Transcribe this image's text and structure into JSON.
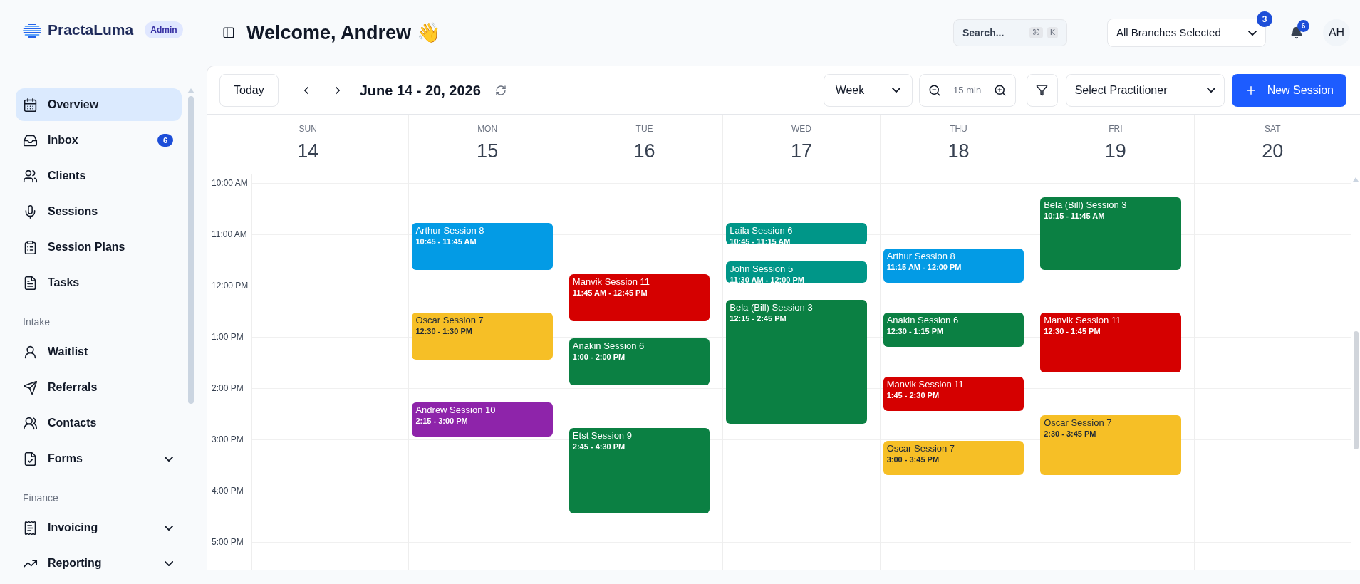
{
  "brand": {
    "name": "PractaLuma",
    "role": "Admin"
  },
  "sidebar": {
    "sections": [
      {
        "items": [
          {
            "label": "Overview",
            "selected": true,
            "collapsible": false
          },
          {
            "label": "Inbox",
            "selected": false,
            "badge": "6",
            "collapsible": false
          },
          {
            "label": "Clients",
            "selected": false,
            "collapsible": false
          },
          {
            "label": "Sessions",
            "selected": false,
            "collapsible": false
          },
          {
            "label": "Session Plans",
            "selected": false,
            "collapsible": false
          },
          {
            "label": "Tasks",
            "selected": false,
            "collapsible": false
          }
        ]
      },
      {
        "label": "Intake",
        "items": [
          {
            "label": "Waitlist",
            "selected": false,
            "collapsible": false
          },
          {
            "label": "Referrals",
            "selected": false,
            "collapsible": false
          },
          {
            "label": "Contacts",
            "selected": false,
            "collapsible": false
          },
          {
            "label": "Forms",
            "selected": false,
            "collapsible": true
          }
        ]
      },
      {
        "label": "Finance",
        "items": [
          {
            "label": "Invoicing",
            "selected": false,
            "collapsible": true
          },
          {
            "label": "Reporting",
            "selected": false,
            "collapsible": true
          }
        ]
      }
    ]
  },
  "header": {
    "title": "Welcome, Andrew 👋",
    "search": {
      "placeholder": "Search...",
      "keys": [
        "⌘",
        "K"
      ]
    },
    "branches": {
      "value": "All Branches Selected",
      "count": "3"
    },
    "notifications": "6",
    "avatar": "AH"
  },
  "toolbar": {
    "today": "Today",
    "range": "June 14 - 20, 2026",
    "view": "Week",
    "interval": "15 min",
    "practitioner": "Select Practitioner",
    "new_session": "New Session"
  },
  "times": [
    "10:00 AM",
    "11:00 AM",
    "12:00 PM",
    "1:00 PM",
    "2:00 PM",
    "3:00 PM",
    "4:00 PM",
    "5:00 PM"
  ],
  "days": [
    {
      "weekday": "SUN",
      "date": "14"
    },
    {
      "weekday": "MON",
      "date": "15",
      "events": [
        {
          "title": "Arthur Session 8",
          "time": "10:45 - 11:45 AM",
          "color": "#039be5"
        },
        {
          "title": "Oscar Session 7",
          "time": "12:30 - 1:30 PM",
          "color": "#f6bf26"
        },
        {
          "title": "Andrew Session 10",
          "time": "2:15 - 3:00 PM",
          "color": "#8e24aa"
        }
      ]
    },
    {
      "weekday": "TUE",
      "date": "16",
      "events": [
        {
          "title": "Manvik Session 11",
          "time": "11:45 AM - 12:45 PM",
          "color": "#d50000"
        },
        {
          "title": "Anakin Session 6",
          "time": "1:00 - 2:00 PM",
          "color": "#0b8043"
        },
        {
          "title": "Etst Session 9",
          "time": "2:45 - 4:30 PM",
          "color": "#0b8043"
        }
      ]
    },
    {
      "weekday": "WED",
      "date": "17",
      "events": [
        {
          "title": "Laila Session 6",
          "time": "10:45 - 11:15 AM",
          "color": "#009688"
        },
        {
          "title": "John Session 5",
          "time": "11:30 AM - 12:00 PM",
          "color": "#009688"
        },
        {
          "title": "Bela (Bill) Session 3",
          "time": "12:15 - 2:45 PM",
          "color": "#0b8043"
        }
      ]
    },
    {
      "weekday": "THU",
      "date": "18",
      "events": [
        {
          "title": "Arthur Session 8",
          "time": "11:15 AM - 12:00 PM",
          "color": "#039be5"
        },
        {
          "title": "Anakin Session 6",
          "time": "12:30 - 1:15 PM",
          "color": "#0b8043"
        },
        {
          "title": "Manvik Session 11",
          "time": "1:45 - 2:30 PM",
          "color": "#d50000"
        },
        {
          "title": "Oscar Session 7",
          "time": "3:00 - 3:45 PM",
          "color": "#f6bf26"
        }
      ]
    },
    {
      "weekday": "FRI",
      "date": "19",
      "events": [
        {
          "title": "Bela (Bill) Session 3",
          "time": "10:15 - 11:45 AM",
          "color": "#0b8043"
        },
        {
          "title": "Manvik Session 11",
          "time": "12:30 - 1:45 PM",
          "color": "#d50000"
        },
        {
          "title": "Oscar Session 7",
          "time": "2:30 - 3:45 PM",
          "color": "#f6bf26"
        }
      ]
    },
    {
      "weekday": "SAT",
      "date": "20"
    }
  ]
}
